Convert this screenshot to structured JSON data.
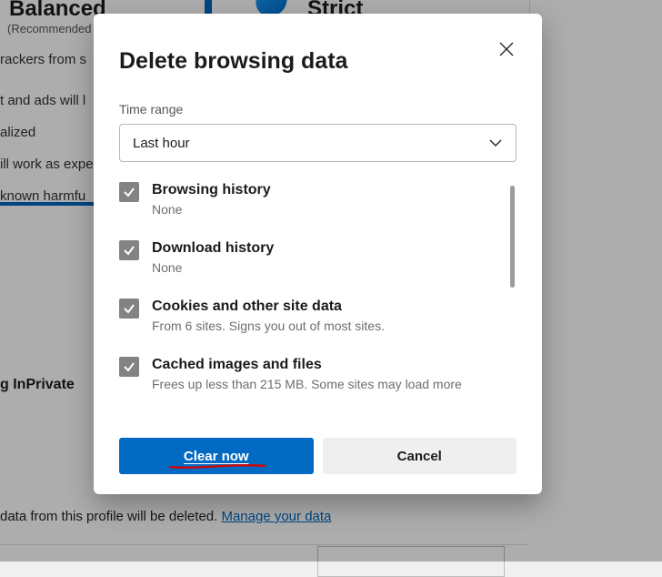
{
  "background": {
    "balanced_title": "Balanced",
    "balanced_rec": "(Recommended",
    "strict_title": "Strict",
    "line1": "rackers from s",
    "line2": "t and ads will l",
    "line3": "alized",
    "line4": "ill work as expe",
    "line5": "known harmfu",
    "inprivate": "g InPrivate",
    "bottom_text_prefix": "data from this profile will be deleted. ",
    "bottom_link": "Manage your data"
  },
  "modal": {
    "title": "Delete browsing data",
    "time_range_label": "Time range",
    "time_range_value": "Last hour",
    "items": [
      {
        "title": "Browsing history",
        "sub": "None"
      },
      {
        "title": "Download history",
        "sub": "None"
      },
      {
        "title": "Cookies and other site data",
        "sub": "From 6 sites. Signs you out of most sites."
      },
      {
        "title": "Cached images and files",
        "sub": "Frees up less than 215 MB. Some sites may load more"
      }
    ],
    "clear_label": "Clear now",
    "cancel_label": "Cancel"
  }
}
